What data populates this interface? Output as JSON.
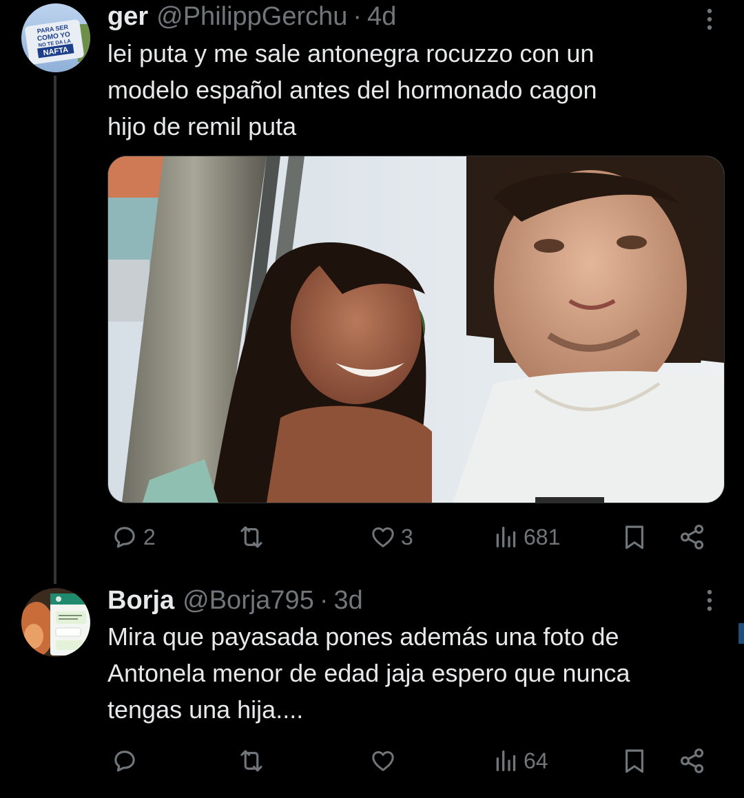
{
  "tweets": [
    {
      "name": "ger",
      "handle": "@PhilippGerchu",
      "separator": "·",
      "time": "4d",
      "text": "lei puta y me sale antonegra rocuzzo con un\nmodelo español antes del hormonado cagon\nhijo de remil puta",
      "avatar_icon": "avatar-image",
      "avatar_text": [
        "PARA SER",
        "COMO YO",
        "NO TE DA LA",
        "NAFTA"
      ],
      "actions": {
        "replies": "2",
        "retweets": "",
        "likes": "3",
        "views": "681"
      }
    },
    {
      "name": "Borja",
      "handle": "@Borja795",
      "separator": "·",
      "time": "3d",
      "text": "Mira que payasada pones además una foto de\nAntonela menor de edad jaja espero que nunca\ntengas una hija....",
      "avatar_icon": "avatar-image",
      "actions": {
        "replies": "",
        "retweets": "",
        "likes": "",
        "views": "64"
      }
    }
  ],
  "colors": {
    "background": "#000000",
    "primary_text": "#e7e9ea",
    "secondary_text": "#71767b",
    "thread_line": "#333639"
  },
  "icons": [
    "reply-icon",
    "retweet-icon",
    "like-icon",
    "views-icon",
    "bookmark-icon",
    "share-icon",
    "more-icon"
  ]
}
